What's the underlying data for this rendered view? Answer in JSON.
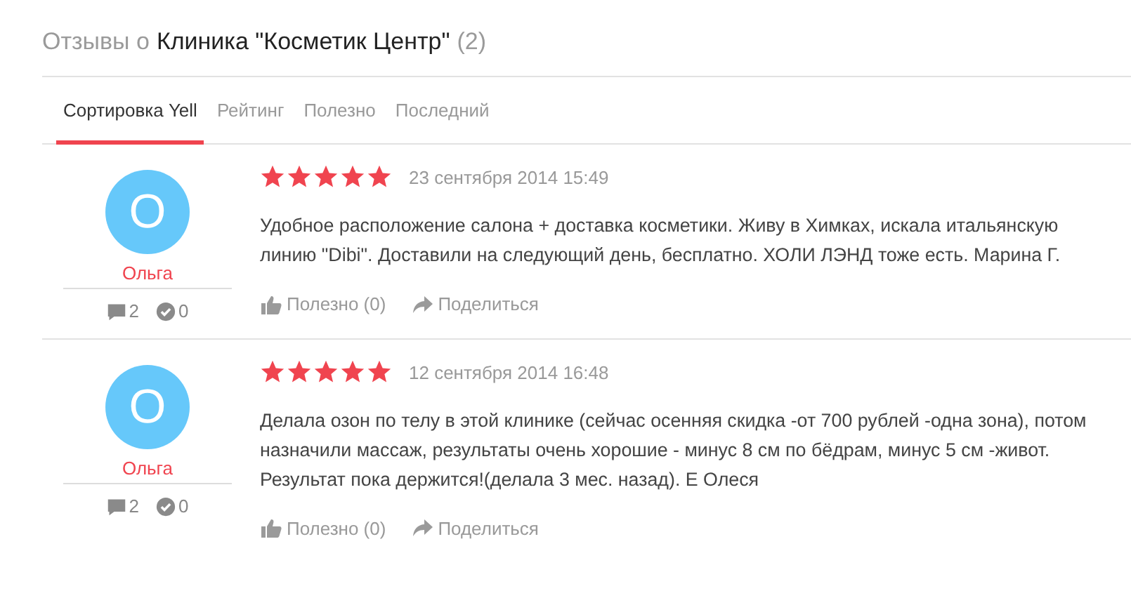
{
  "header": {
    "prefix": "Отзывы о",
    "business": "Клиника \"Косметик Центр\"",
    "count": "(2)"
  },
  "tabs": [
    {
      "label": "Сортировка Yell",
      "selected": true
    },
    {
      "label": "Рейтинг",
      "selected": false
    },
    {
      "label": "Полезно",
      "selected": false
    },
    {
      "label": "Последний",
      "selected": false
    }
  ],
  "reviews": [
    {
      "avatar_letter": "O",
      "author": "Ольга",
      "comments": "2",
      "confirmations": "0",
      "stars": 5,
      "date": "23 сентября 2014 15:49",
      "text": "Удобное расположение салона + доставка косметики. Живу в Химках, искала итальянскую линию \"Dibi\". Доставили на следующий день, бесплатно. ХОЛИ ЛЭНД тоже есть. Марина Г.",
      "helpful": "Полезно (0)",
      "share": "Поделиться"
    },
    {
      "avatar_letter": "O",
      "author": "Ольга",
      "comments": "2",
      "confirmations": "0",
      "stars": 5,
      "date": "12 сентября 2014 16:48",
      "text": "Делала озон по телу в этой клинике (сейчас осенняя скидка -от 700 рублей -одна зона), потом назначили массаж, результаты очень хорошие - минус 8 см по бёдрам, минус 5 см -живот. Результат пока держится!(делала 3 мес. назад). Е Олеся",
      "helpful": "Полезно (0)",
      "share": "Поделиться"
    }
  ]
}
